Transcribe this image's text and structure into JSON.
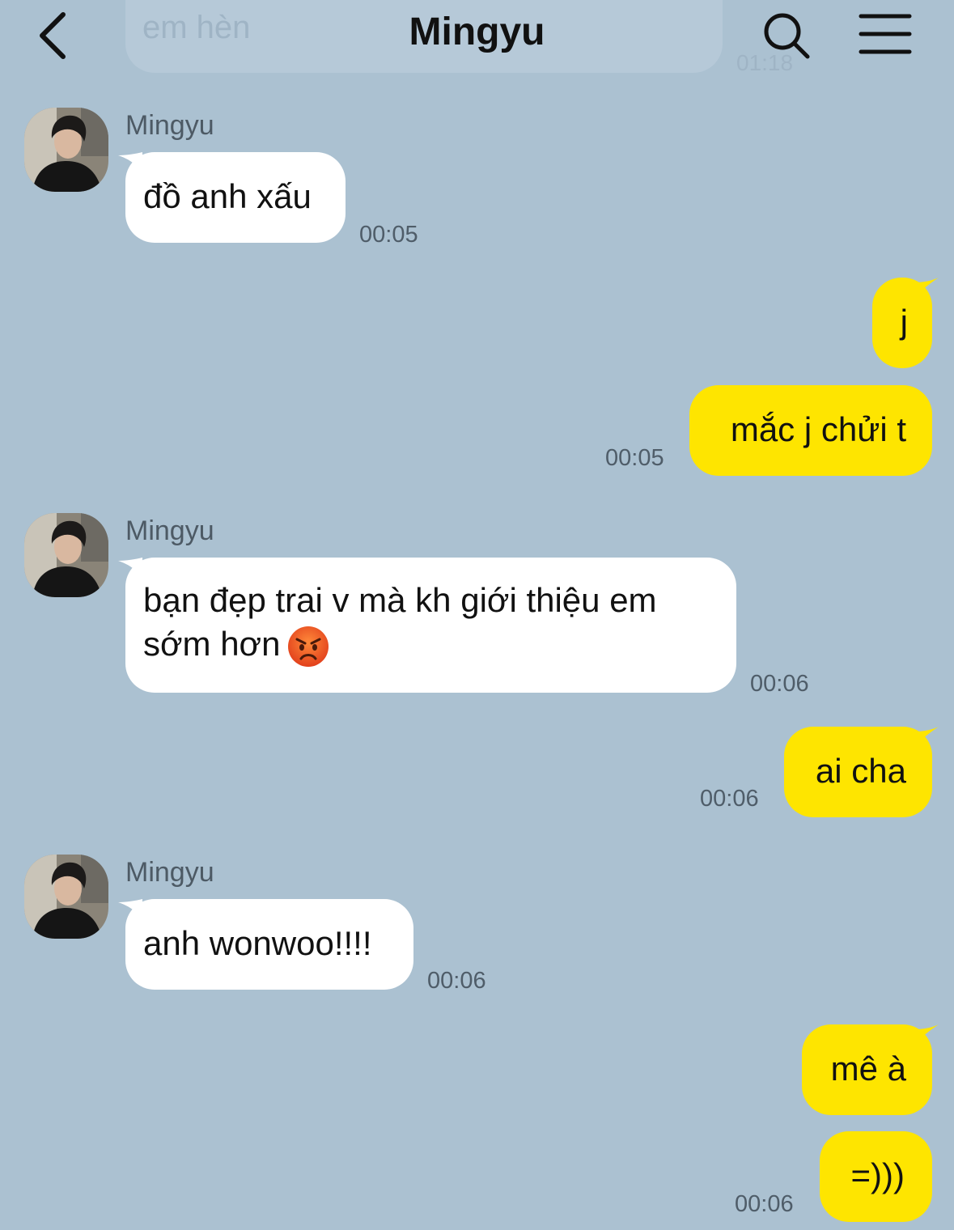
{
  "header": {
    "title": "Mingyu",
    "faded_message_text": "em hèn",
    "faded_message_time": "01:18"
  },
  "colors": {
    "background": "#abc1d1",
    "incoming_bubble": "#ffffff",
    "outgoing_bubble": "#fee500"
  },
  "messages": [
    {
      "direction": "in",
      "sender": "Mingyu",
      "text": "đồ anh xấu",
      "time": "00:05"
    },
    {
      "direction": "out",
      "text": "j",
      "time": ""
    },
    {
      "direction": "out",
      "text": "mắc j chửi t",
      "time": "00:05"
    },
    {
      "direction": "in",
      "sender": "Mingyu",
      "text_line1": "bạn đẹp trai v mà kh giới thiệu em",
      "text_line2": "sớm hơn",
      "emoji": "angry-face",
      "time": "00:06"
    },
    {
      "direction": "out",
      "text": "ai cha",
      "time": "00:06"
    },
    {
      "direction": "in",
      "sender": "Mingyu",
      "text": "anh wonwoo!!!!",
      "time": "00:06"
    },
    {
      "direction": "out",
      "text": "mê à",
      "time": ""
    },
    {
      "direction": "out",
      "text": "=)))",
      "time": "00:06"
    }
  ],
  "icons": [
    "back-chevron-icon",
    "search-icon",
    "menu-icon",
    "angry-face-emoji"
  ]
}
